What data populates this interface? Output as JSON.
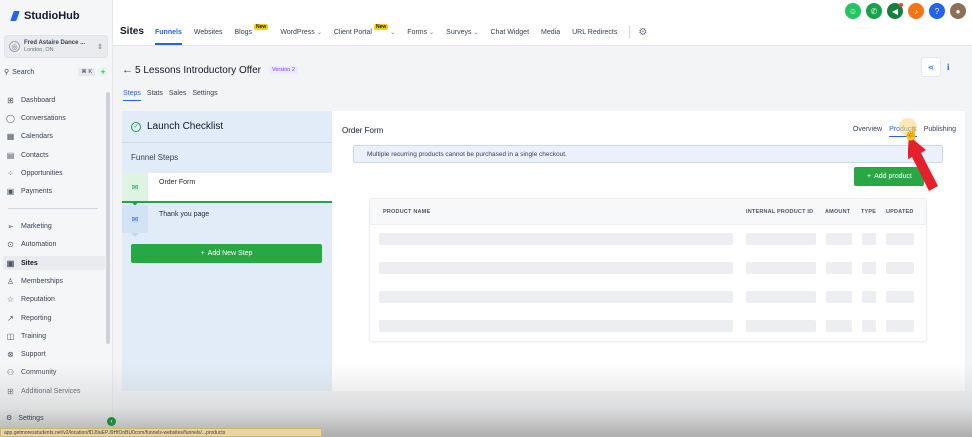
{
  "brand": {
    "name": "StudioHub"
  },
  "account": {
    "name": "Fred Astaire Dance ...",
    "location": "London, ON"
  },
  "search": {
    "label": "Search",
    "shortcut": "⌘ K",
    "add": "+"
  },
  "sidebar": {
    "items": [
      {
        "label": "Dashboard",
        "icon": "grid-icon"
      },
      {
        "label": "Conversations",
        "icon": "chat-icon"
      },
      {
        "label": "Calendars",
        "icon": "calendar-icon"
      },
      {
        "label": "Contacts",
        "icon": "contacts-icon"
      },
      {
        "label": "Opportunities",
        "icon": "opportunities-icon"
      },
      {
        "label": "Payments",
        "icon": "payments-icon"
      },
      {
        "label": "Marketing",
        "icon": "send-icon"
      },
      {
        "label": "Automation",
        "icon": "automation-icon"
      },
      {
        "label": "Sites",
        "icon": "sites-icon",
        "active": true
      },
      {
        "label": "Memberships",
        "icon": "memberships-icon"
      },
      {
        "label": "Reputation",
        "icon": "star-icon"
      },
      {
        "label": "Reporting",
        "icon": "chart-icon"
      },
      {
        "label": "Training",
        "icon": "book-icon"
      },
      {
        "label": "Support",
        "icon": "support-icon"
      },
      {
        "label": "Community",
        "icon": "community-icon"
      },
      {
        "label": "Additional Services",
        "icon": "cart-icon"
      }
    ],
    "settings_label": "Settings"
  },
  "topbar": {
    "title": "Sites",
    "tabs": [
      {
        "label": "Funnels",
        "active": true
      },
      {
        "label": "Websites"
      },
      {
        "label": "Blogs",
        "badge": "New"
      },
      {
        "label": "WordPress",
        "dropdown": true
      },
      {
        "label": "Client Portal",
        "badge": "New",
        "dropdown": true
      },
      {
        "label": "Forms",
        "dropdown": true
      },
      {
        "label": "Surveys",
        "dropdown": true
      },
      {
        "label": "Chat Widget"
      },
      {
        "label": "Media"
      },
      {
        "label": "URL Redirects"
      }
    ]
  },
  "top_icons": [
    {
      "name": "assistant-icon",
      "color": "#22c55e"
    },
    {
      "name": "phone-icon",
      "color": "#16a34a"
    },
    {
      "name": "megaphone-icon",
      "color": "#15803d"
    },
    {
      "name": "bell-icon",
      "color": "#f97316"
    },
    {
      "name": "help-icon",
      "color": "#2563eb"
    }
  ],
  "header": {
    "title": "5 Lessons Introductory Offer",
    "version": "Version 2",
    "subtabs": [
      {
        "label": "Steps",
        "active": true
      },
      {
        "label": "Stats"
      },
      {
        "label": "Sales"
      },
      {
        "label": "Settings"
      }
    ]
  },
  "left_panel": {
    "checklist_title": "Launch Checklist",
    "funnel_steps_title": "Funnel Steps",
    "steps": [
      {
        "label": "Order Form"
      },
      {
        "label": "Thank you page"
      }
    ],
    "add_step_label": "Add New Step"
  },
  "right_panel": {
    "title": "Order Form",
    "tabs": [
      {
        "label": "Overview"
      },
      {
        "label": "Products",
        "active": true
      },
      {
        "label": "Publishing"
      }
    ],
    "alert": "Multiple recurring products cannot be purchased in a single checkout.",
    "add_product_label": "Add product",
    "table": {
      "columns": [
        "PRODUCT NAME",
        "INTERNAL PRODUCT ID",
        "AMOUNT",
        "TYPE",
        "UPDATED"
      ]
    }
  },
  "status_url": "app.getmoresstudents.net/v2/location/fDJ9uEPJ9HfOnBU0com/funnels-websites/funnels/...products",
  "colors": {
    "accent": "#2563eb",
    "primary_green": "#27a844",
    "annotation_red": "#e5202b"
  }
}
